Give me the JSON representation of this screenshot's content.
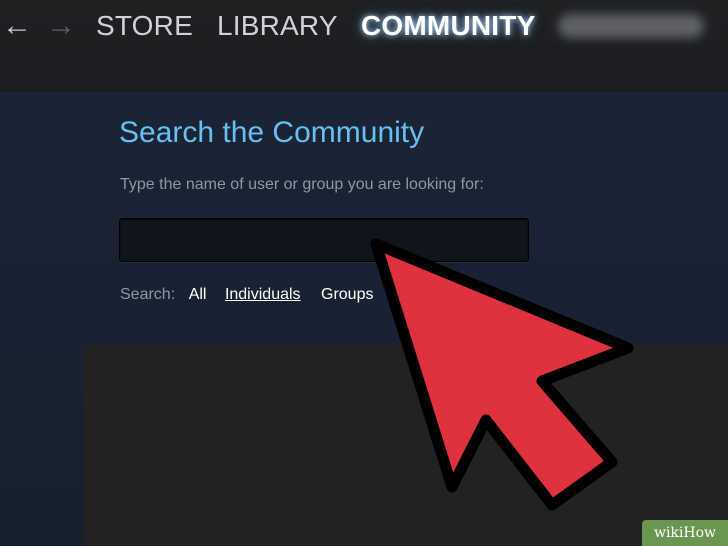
{
  "nav": {
    "back_icon": "←",
    "forward_icon": "→",
    "store": "STORE",
    "library": "LIBRARY",
    "community": "COMMUNITY"
  },
  "community_search": {
    "title": "Search the Community",
    "hint": "Type the name of user or group you are looking for:",
    "input_value": "",
    "filters": {
      "label": "Search:",
      "all": "All",
      "individuals": "Individuals",
      "groups": "Groups"
    }
  },
  "watermark": "wikiHow",
  "colors": {
    "accent_blue": "#66c0f4",
    "cursor_red": "#e0313f"
  },
  "icons": [
    "back-arrow-icon",
    "forward-arrow-icon",
    "mouse-cursor-icon"
  ]
}
